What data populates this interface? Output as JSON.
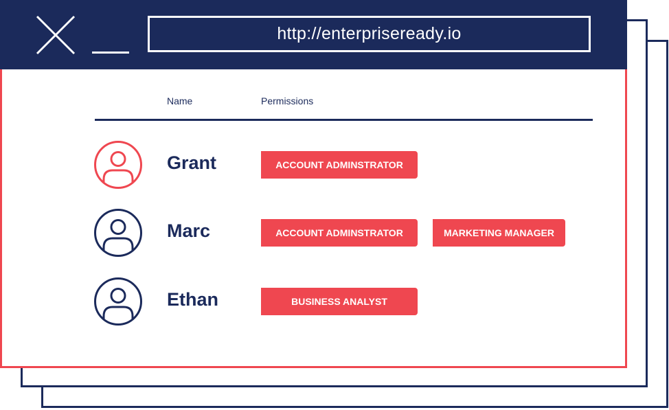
{
  "window": {
    "url": "http://enterpriseready.io"
  },
  "table": {
    "headers": {
      "name": "Name",
      "permissions": "Permissions"
    },
    "rows": [
      {
        "name": "Grant",
        "avatar_icon": "user-icon",
        "avatar_color": "#ef4750",
        "permissions": [
          "ACCOUNT ADMINSTRATOR"
        ]
      },
      {
        "name": "Marc",
        "avatar_icon": "user-icon",
        "avatar_color": "#1b2a5b",
        "permissions": [
          "ACCOUNT ADMINSTRATOR",
          "MARKETING MANAGER"
        ]
      },
      {
        "name": "Ethan",
        "avatar_icon": "user-icon",
        "avatar_color": "#1b2a5b",
        "permissions": [
          "BUSINESS ANALYST"
        ]
      }
    ]
  },
  "colors": {
    "navy": "#1b2a5b",
    "accent": "#ef4750",
    "background": "#ffffff"
  },
  "icons": {
    "close": "close-icon",
    "minimize": "minimize-icon"
  }
}
